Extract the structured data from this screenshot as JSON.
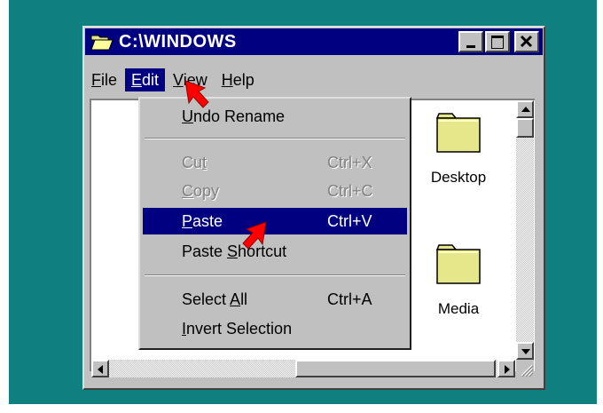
{
  "window": {
    "title": "C:\\WINDOWS"
  },
  "menubar": {
    "items": [
      {
        "label": "File",
        "underline": "F",
        "rest": "ile"
      },
      {
        "label": "Edit",
        "underline": "E",
        "rest": "dit"
      },
      {
        "label": "View",
        "underline": "V",
        "rest": "iew"
      },
      {
        "label": "Help",
        "underline": "H",
        "rest": "elp"
      }
    ]
  },
  "edit_menu": {
    "undo": {
      "pre": "",
      "u": "U",
      "post": "ndo Rename"
    },
    "cut": {
      "pre": "Cu",
      "u": "t",
      "post": "",
      "shortcut": "Ctrl+X"
    },
    "copy": {
      "pre": "",
      "u": "C",
      "post": "opy",
      "shortcut": "Ctrl+C"
    },
    "paste": {
      "pre": "",
      "u": "P",
      "post": "aste",
      "shortcut": "Ctrl+V"
    },
    "paste_shortcut": {
      "pre": "Paste ",
      "u": "S",
      "post": "hortcut"
    },
    "select_all": {
      "pre": "Select ",
      "u": "A",
      "post": "ll",
      "shortcut": "Ctrl+A"
    },
    "invert": {
      "pre": "",
      "u": "I",
      "post": "nvert Selection"
    }
  },
  "files": [
    {
      "name": "Desktop"
    },
    {
      "name": "Media"
    }
  ],
  "colors": {
    "desktop": "#0f7f80",
    "titlebar": "#000080",
    "selection": "#000080",
    "folder": "#e6e68a",
    "pointer": "#ff0000"
  }
}
